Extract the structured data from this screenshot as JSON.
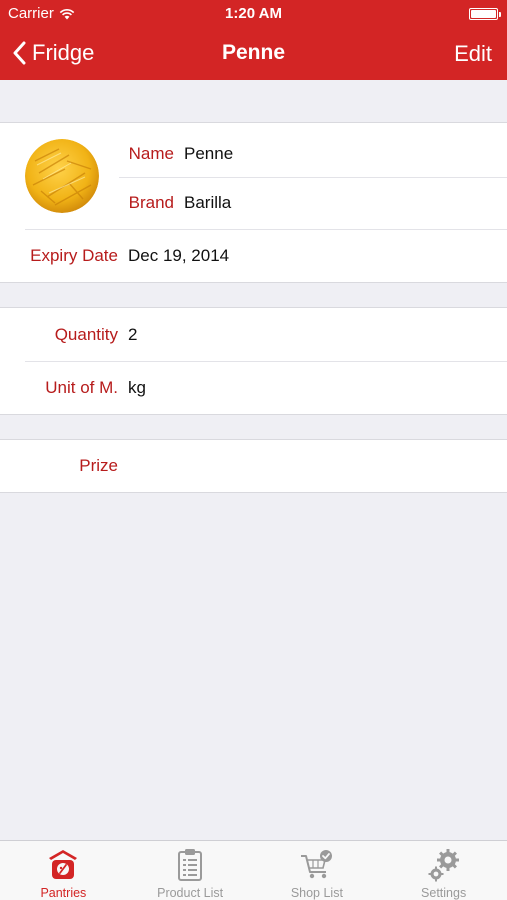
{
  "status_bar": {
    "carrier": "Carrier",
    "time": "1:20 AM"
  },
  "nav": {
    "back_label": "Fridge",
    "title": "Penne",
    "edit_label": "Edit"
  },
  "product": {
    "name_label": "Name",
    "name_value": "Penne",
    "brand_label": "Brand",
    "brand_value": "Barilla",
    "expiry_label": "Expiry Date",
    "expiry_value": "Dec 19, 2014"
  },
  "quantity": {
    "quantity_label": "Quantity",
    "quantity_value": "2",
    "unit_label": "Unit of M.",
    "unit_value": "kg"
  },
  "price": {
    "prize_label": "Prize",
    "prize_value": ""
  },
  "tabs": [
    {
      "label": "Pantries",
      "icon": "pantry-scale-icon",
      "active": true
    },
    {
      "label": "Product List",
      "icon": "clipboard-list-icon",
      "active": false
    },
    {
      "label": "Shop List",
      "icon": "cart-check-icon",
      "active": false
    },
    {
      "label": "Settings",
      "icon": "gears-icon",
      "active": false
    }
  ],
  "colors": {
    "accent": "#d32525",
    "label": "#b71c1c",
    "background": "#efeff4",
    "inactive_tab": "#9a9a9a"
  }
}
